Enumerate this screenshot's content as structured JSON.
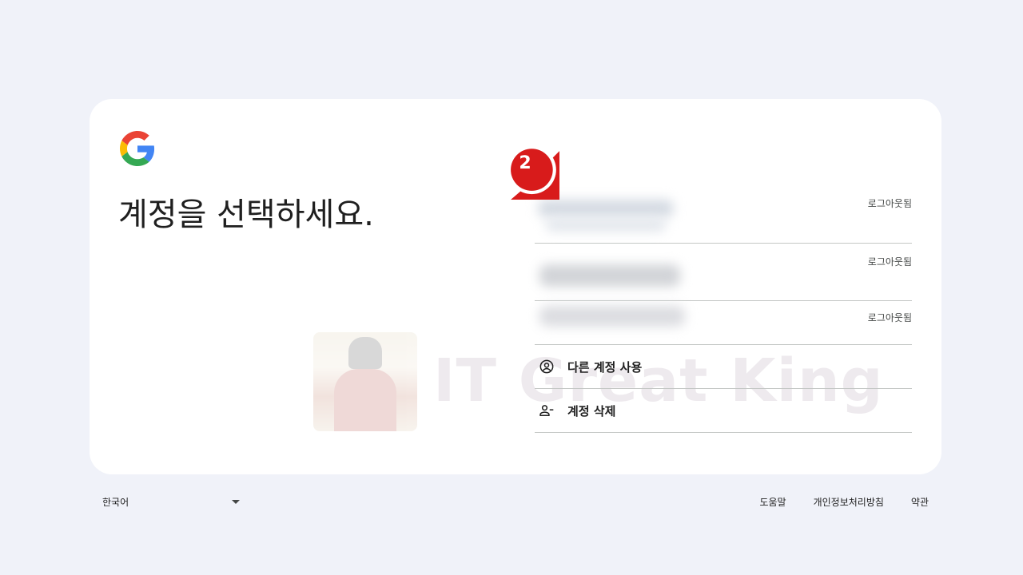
{
  "heading": "계정을 선택하세요.",
  "accounts": [
    {
      "status": "로그아웃됨"
    },
    {
      "status": "로그아웃됨"
    },
    {
      "status": "로그아웃됨"
    }
  ],
  "actions": {
    "use_another": "다른 계정 사용",
    "remove": "계정 삭제"
  },
  "annotation": {
    "step": "2"
  },
  "watermark": "IT Great King",
  "footer": {
    "language": "한국어",
    "help": "도움말",
    "privacy": "개인정보처리방침",
    "terms": "약관"
  },
  "colors": {
    "background": "#f0f2f9",
    "card": "#ffffff",
    "badge": "#d81b1b",
    "divider": "#c4c7c5"
  }
}
